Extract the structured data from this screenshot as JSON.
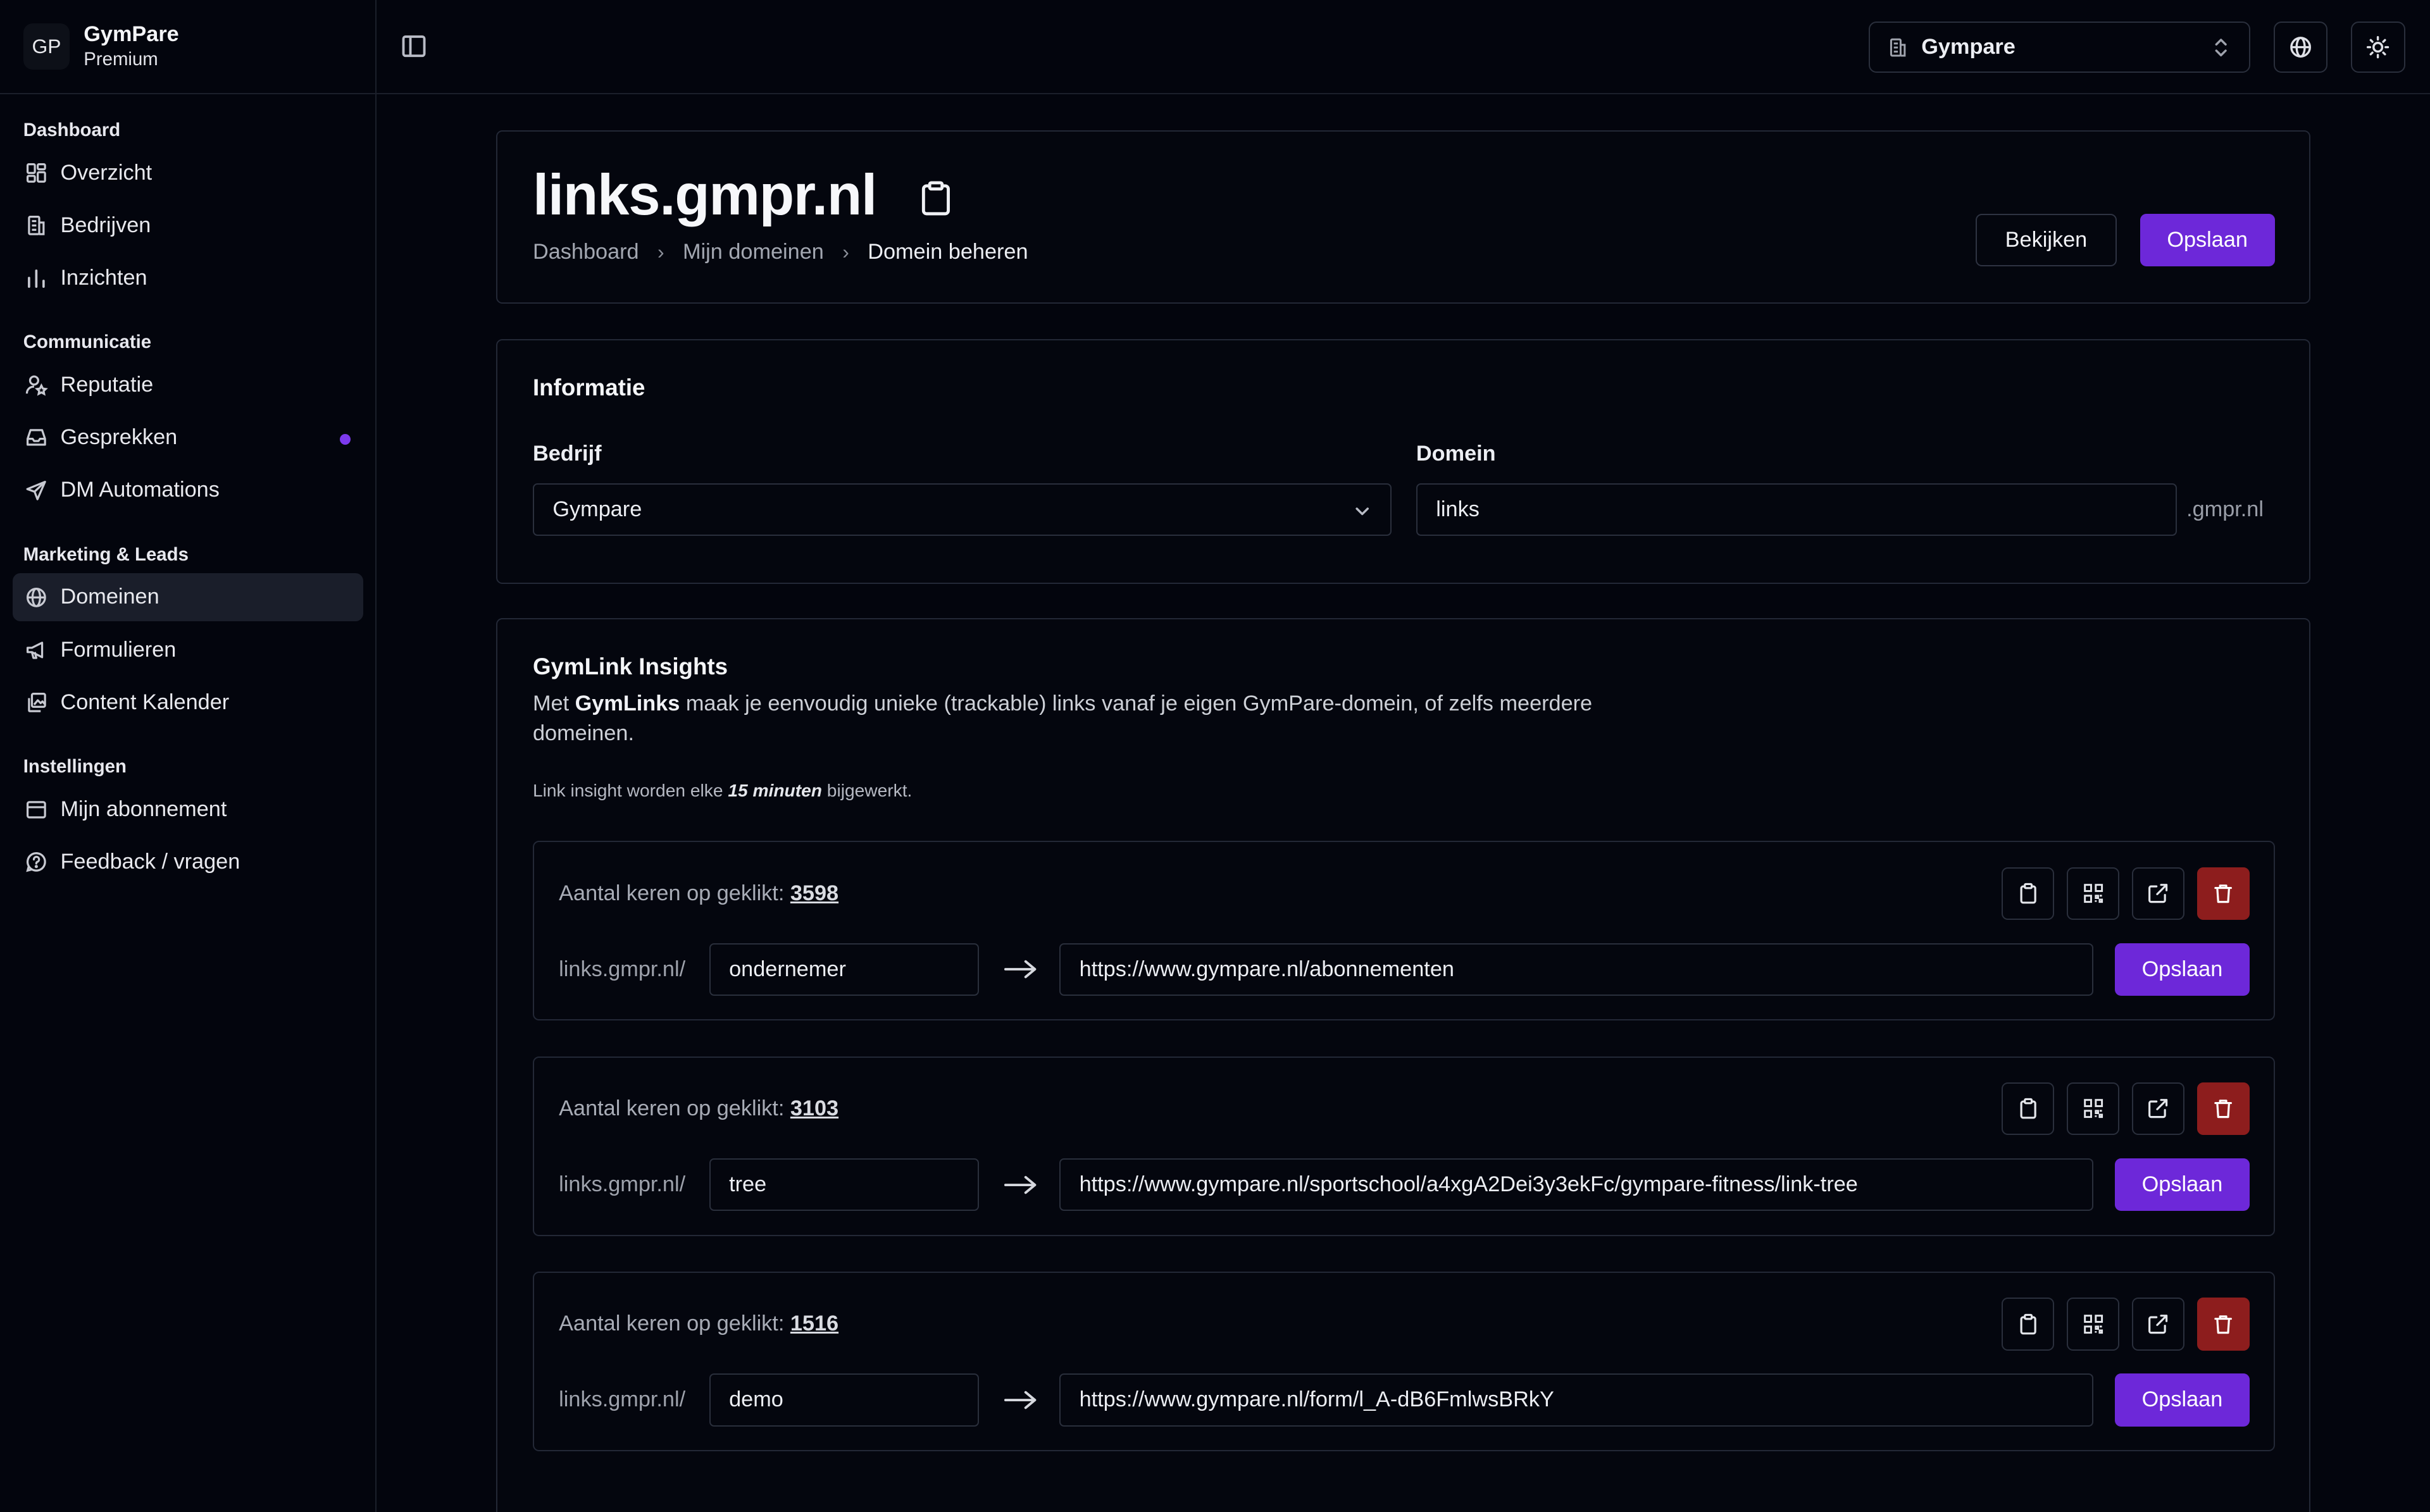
{
  "brand": {
    "logo": "GP",
    "name": "GymPare",
    "plan": "Premium"
  },
  "sidebar": {
    "sections": [
      {
        "title": "Dashboard",
        "items": [
          {
            "label": "Overzicht",
            "icon": "layout-grid-icon"
          },
          {
            "label": "Bedrijven",
            "icon": "building-icon"
          },
          {
            "label": "Inzichten",
            "icon": "bar-chart-icon"
          }
        ]
      },
      {
        "title": "Communicatie",
        "items": [
          {
            "label": "Reputatie",
            "icon": "user-star-icon"
          },
          {
            "label": "Gesprekken",
            "icon": "inbox-icon",
            "dot": true
          },
          {
            "label": "DM Automations",
            "icon": "send-icon"
          }
        ]
      },
      {
        "title": "Marketing & Leads",
        "items": [
          {
            "label": "Domeinen",
            "icon": "globe-icon",
            "active": true
          },
          {
            "label": "Formulieren",
            "icon": "megaphone-icon"
          },
          {
            "label": "Content Kalender",
            "icon": "gallery-icon"
          }
        ]
      },
      {
        "title": "Instellingen",
        "items": [
          {
            "label": "Mijn abonnement",
            "icon": "wallet-icon"
          },
          {
            "label": "Feedback / vragen",
            "icon": "help-circle-icon"
          }
        ]
      }
    ]
  },
  "topbar": {
    "org_name": "Gympare"
  },
  "header": {
    "title": "links.gmpr.nl",
    "breadcrumb": [
      "Dashboard",
      "Mijn domeinen",
      "Domein beheren"
    ],
    "view_label": "Bekijken",
    "save_label": "Opslaan"
  },
  "info": {
    "title": "Informatie",
    "company_label": "Bedrijf",
    "company_value": "Gympare",
    "domain_label": "Domein",
    "domain_value": "links",
    "domain_suffix": ".gmpr.nl"
  },
  "insights": {
    "title": "GymLink Insights",
    "desc_pre": "Met ",
    "desc_bold": "GymLinks",
    "desc_post": " maak je eenvoudig unieke (trackable) links vanaf je eigen GymPare-domein, of zelfs meerdere domeinen.",
    "note_pre": "Link insight worden elke ",
    "note_bold": "15 minuten",
    "note_post": " bijgewerkt.",
    "clicks_label": "Aantal keren op geklikt: ",
    "prefix": "links.gmpr.nl/",
    "save_label": "Opslaan",
    "links": [
      {
        "clicks": "3598",
        "slug": "ondernemer",
        "target": "https://www.gympare.nl/abonnementen"
      },
      {
        "clicks": "3103",
        "slug": "tree",
        "target": "https://www.gympare.nl/sportschool/a4xgA2Dei3y3ekFc/gympare-fitness/link-tree"
      },
      {
        "clicks": "1516",
        "slug": "demo",
        "target": "https://www.gympare.nl/form/l_A-dB6FmlwsBRkY"
      }
    ]
  },
  "colors": {
    "accent": "#6d28d9",
    "danger": "#8d1d1d",
    "background": "#03050d"
  }
}
